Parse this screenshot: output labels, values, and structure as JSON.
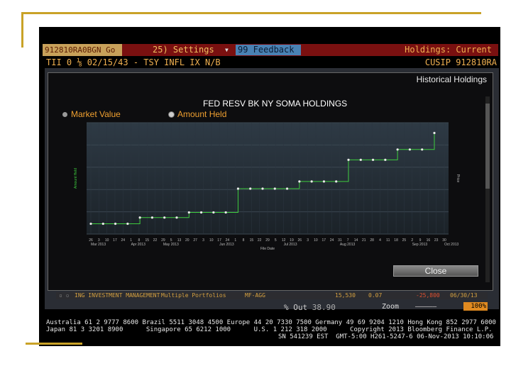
{
  "top_bar": {
    "security_code": "912810RA0BGN Go",
    "settings_label": "25) Settings",
    "feedback_label": "99 Feedback",
    "holdings_label": "Holdings: Current"
  },
  "security": {
    "description": "TII 0 ⅛ 02/15/43 - TSY INFL IX N/B",
    "cusip": "CUSIP 912810RA"
  },
  "window": {
    "title": "Historical Holdings",
    "chart_title": "FED RESV BK NY SOMA HOLDINGS",
    "legend_market_value": "Market Value",
    "legend_amount_held": "Amount Held",
    "close_label": "Close"
  },
  "chart_data": {
    "type": "line",
    "title": "FED RESV BK NY SOMA HOLDINGS",
    "xlabel": "File Date",
    "ylabel": "Amount Held",
    "y2label": "Price",
    "series": [
      {
        "name": "Amount Held",
        "values": [
          1,
          1,
          1,
          1,
          1.3,
          1.3,
          1.3,
          1.3,
          1.55,
          1.55,
          1.55,
          1.55,
          2.7,
          2.7,
          2.7,
          2.7,
          2.7,
          3.05,
          3.05,
          3.05,
          3.05,
          4.1,
          4.1,
          4.1,
          4.1,
          4.6,
          4.6,
          4.6,
          5.4
        ]
      }
    ],
    "tick_labels": [
      "26",
      "3",
      "10",
      "17",
      "24",
      "1",
      "8",
      "15",
      "22",
      "29",
      "5",
      "13",
      "20",
      "27",
      "3",
      "10",
      "17",
      "24",
      "1",
      "8",
      "15",
      "22",
      "29",
      "5",
      "12",
      "19",
      "26",
      "3",
      "10",
      "17",
      "24",
      "31",
      "7",
      "14",
      "21",
      "28",
      "4",
      "11",
      "18",
      "25",
      "2",
      "9",
      "16",
      "23",
      "30"
    ],
    "month_labels": [
      "Mar 2013",
      "Apr 2013",
      "May 2013",
      "Jun 2013",
      "Jul 2013",
      "Aug 2013",
      "Sep 2013",
      "Oct 2013"
    ],
    "color": "#3ecc3e",
    "grid": true
  },
  "holdings_row": {
    "name": "ING INVESTMENT MANAGEMENT",
    "portfolio": "Multiple Portfolios",
    "source": "MF-AGG",
    "position": "15,530",
    "pct": "0.07",
    "change": "-25,800",
    "date": "06/30/13"
  },
  "status": {
    "pct_out_label": "% Out",
    "pct_out_value": "38.90",
    "zoom_label": "Zoom",
    "zoom_value": "100%"
  },
  "footer": {
    "line1": "Australia 61 2 9777 8600 Brazil 5511 3048 4500 Europe 44 20 7330 7500 Germany 49 69 9204 1210 Hong Kong 852 2977 6000",
    "line2": "Japan 81 3 3201 8900      Singapore 65 6212 1000      U.S. 1 212 318 2000      Copyright 2013 Bloomberg Finance L.P.",
    "line3": "SN 541239 EST  GMT-5:00 H261-5247-6 06-Nov-2013 10:10:06"
  }
}
